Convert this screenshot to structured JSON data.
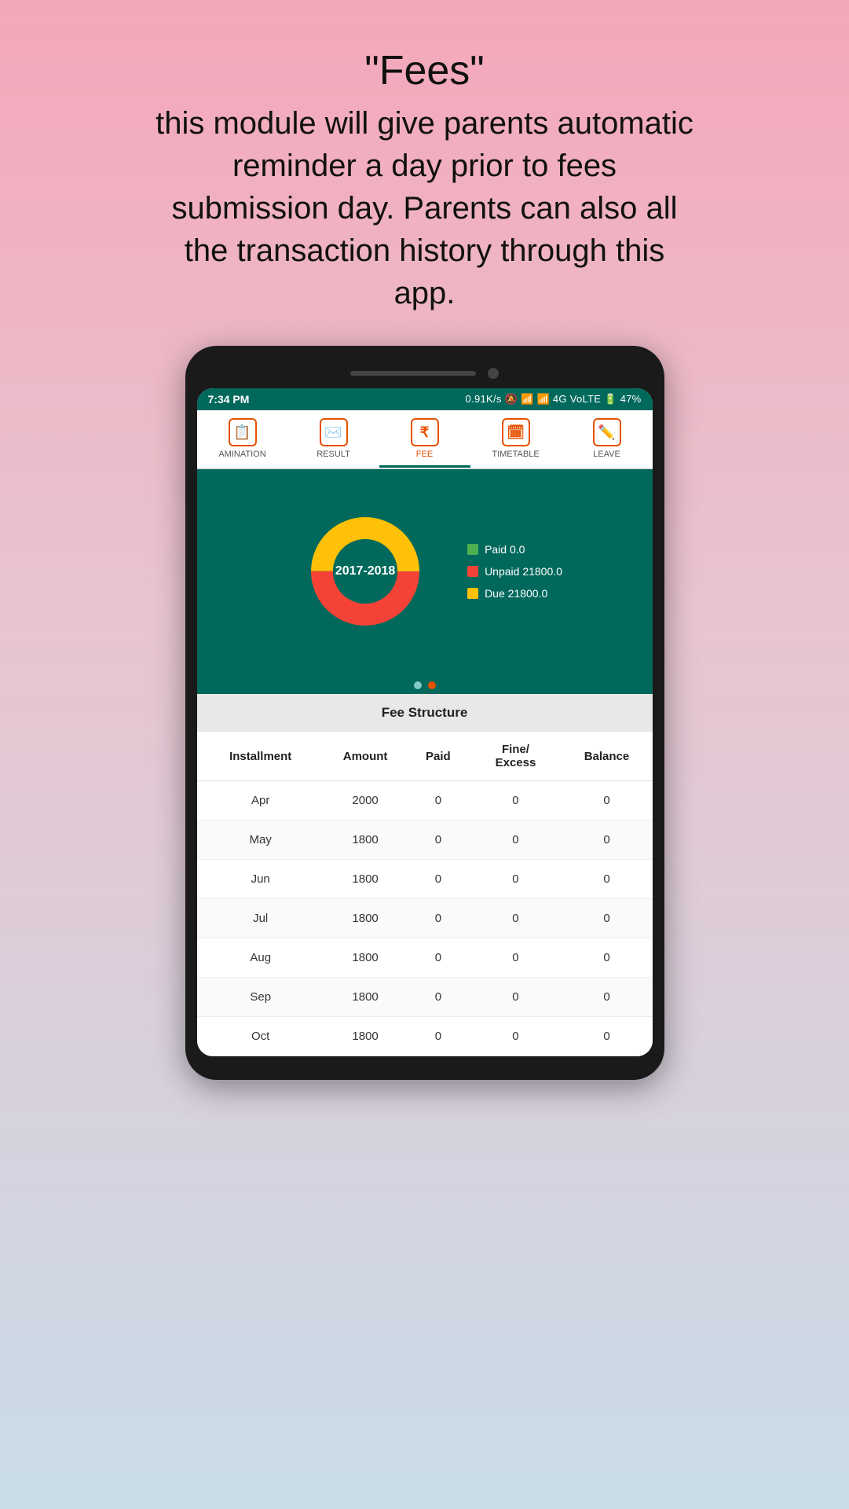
{
  "header": {
    "title": "\"Fees\"",
    "description": "this module will give parents automatic reminder a day prior to fees submission day. Parents can also all the transaction history through this app."
  },
  "statusBar": {
    "time": "7:34 PM",
    "network": "0.91K/s",
    "battery": "47%",
    "networkInfo": "4G VoLTE"
  },
  "navTabs": [
    {
      "id": "examination",
      "label": "AMINATION",
      "icon": "exam-icon",
      "active": false
    },
    {
      "id": "result",
      "label": "RESULT",
      "icon": "result-icon",
      "active": false
    },
    {
      "id": "fee",
      "label": "FEE",
      "icon": "fee-icon",
      "active": true
    },
    {
      "id": "timetable",
      "label": "TIMETABLE",
      "icon": "timetable-icon",
      "active": false
    },
    {
      "id": "leave",
      "label": "LEAVE",
      "icon": "leave-icon",
      "active": false
    }
  ],
  "chart": {
    "year": "2017-2018",
    "legend": [
      {
        "label": "Paid 0.0",
        "color": "#4caf50"
      },
      {
        "label": "Unpaid 21800.0",
        "color": "#f44336"
      },
      {
        "label": "Due 21800.0",
        "color": "#ffc107"
      }
    ],
    "paid": 0,
    "unpaid": 21800,
    "due": 21800
  },
  "feeStructure": {
    "title": "Fee Structure",
    "columns": [
      "Installment",
      "Amount",
      "Paid",
      "Fine/\nExcess",
      "Balance"
    ],
    "rows": [
      {
        "installment": "Apr",
        "amount": "2000",
        "paid": "0",
        "fine": "0",
        "balance": "0"
      },
      {
        "installment": "May",
        "amount": "1800",
        "paid": "0",
        "fine": "0",
        "balance": "0"
      },
      {
        "installment": "Jun",
        "amount": "1800",
        "paid": "0",
        "fine": "0",
        "balance": "0"
      },
      {
        "installment": "Jul",
        "amount": "1800",
        "paid": "0",
        "fine": "0",
        "balance": "0"
      },
      {
        "installment": "Aug",
        "amount": "1800",
        "paid": "0",
        "fine": "0",
        "balance": "0"
      },
      {
        "installment": "Sep",
        "amount": "1800",
        "paid": "0",
        "fine": "0",
        "balance": "0"
      },
      {
        "installment": "Oct",
        "amount": "1800",
        "paid": "0",
        "fine": "0",
        "balance": "0"
      }
    ]
  }
}
